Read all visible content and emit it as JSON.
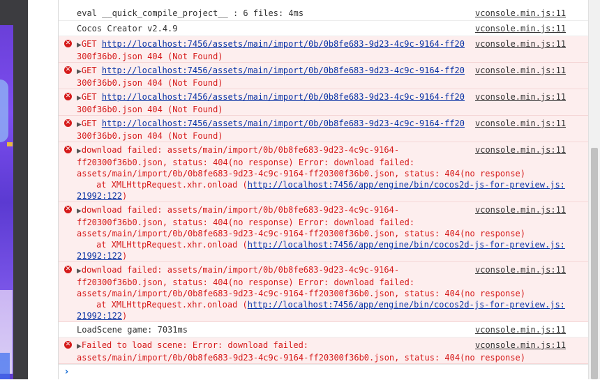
{
  "colors": {
    "error_text": "#d51b1b",
    "error_bg": "#fdeeee",
    "link": "#0a33a5",
    "prompt": "#1a6fd6"
  },
  "console": {
    "rows": [
      {
        "type": "log",
        "lines": [
          "eval __quick_compile_project__ : 6 files: 4ms"
        ],
        "source": "vconsole.min.js:11"
      },
      {
        "type": "log",
        "lines": [
          "Cocos Creator v2.4.9"
        ],
        "source": "vconsole.min.js:11"
      },
      {
        "type": "error",
        "prefix": "GET ",
        "url": "http://localhost:7456/assets/main/import/0b/0b8fe683-9d23-4c9c-9164-ff20",
        "line2": "300f36b0.json 404 (Not Found)",
        "source": "vconsole.min.js:11"
      },
      {
        "type": "error",
        "prefix": "GET ",
        "url": "http://localhost:7456/assets/main/import/0b/0b8fe683-9d23-4c9c-9164-ff20",
        "line2": "300f36b0.json 404 (Not Found)",
        "source": "vconsole.min.js:11"
      },
      {
        "type": "error",
        "prefix": "GET ",
        "url": "http://localhost:7456/assets/main/import/0b/0b8fe683-9d23-4c9c-9164-ff20",
        "line2": "300f36b0.json 404 (Not Found)",
        "source": "vconsole.min.js:11"
      },
      {
        "type": "error",
        "prefix": "GET ",
        "url": "http://localhost:7456/assets/main/import/0b/0b8fe683-9d23-4c9c-9164-ff20",
        "line2": "300f36b0.json 404 (Not Found)",
        "source": "vconsole.min.js:11"
      },
      {
        "type": "error-stack",
        "line1": "download failed: assets/main/import/0b/0b8fe683-9d23-4c9c-9164-",
        "line2": "ff20300f36b0.json, status: 404(no response) Error: download failed:",
        "line3": "assets/main/import/0b/0b8fe683-9d23-4c9c-9164-ff20300f36b0.json, status: 404(no response)",
        "stack_prefix": "at XMLHttpRequest.xhr.onload (",
        "stack_url": "http://localhost:7456/app/engine/bin/cocos2d-js-for-preview.js:",
        "stack_url2": "21992:122",
        "stack_suffix": ")",
        "source": "vconsole.min.js:11"
      },
      {
        "type": "error-stack",
        "line1": "download failed: assets/main/import/0b/0b8fe683-9d23-4c9c-9164-",
        "line2": "ff20300f36b0.json, status: 404(no response) Error: download failed:",
        "line3": "assets/main/import/0b/0b8fe683-9d23-4c9c-9164-ff20300f36b0.json, status: 404(no response)",
        "stack_prefix": "at XMLHttpRequest.xhr.onload (",
        "stack_url": "http://localhost:7456/app/engine/bin/cocos2d-js-for-preview.js:",
        "stack_url2": "21992:122",
        "stack_suffix": ")",
        "source": "vconsole.min.js:11"
      },
      {
        "type": "error-stack",
        "line1": "download failed: assets/main/import/0b/0b8fe683-9d23-4c9c-9164-",
        "line2": "ff20300f36b0.json, status: 404(no response) Error: download failed:",
        "line3": "assets/main/import/0b/0b8fe683-9d23-4c9c-9164-ff20300f36b0.json, status: 404(no response)",
        "stack_prefix": "at XMLHttpRequest.xhr.onload (",
        "stack_url": "http://localhost:7456/app/engine/bin/cocos2d-js-for-preview.js:",
        "stack_url2": "21992:122",
        "stack_suffix": ")",
        "source": "vconsole.min.js:11"
      },
      {
        "type": "log",
        "lines": [
          "LoadScene game: 7031ms"
        ],
        "source": "vconsole.min.js:11"
      },
      {
        "type": "error-plain",
        "line1": "Failed to load scene: Error: download failed:",
        "line2": "assets/main/import/0b/0b8fe683-9d23-4c9c-9164-ff20300f36b0.json, status: 404(no response)",
        "source": "vconsole.min.js:11"
      }
    ],
    "prompt_symbol": "›",
    "error_icon_glyph": "✕",
    "expand_glyph": "▶"
  }
}
